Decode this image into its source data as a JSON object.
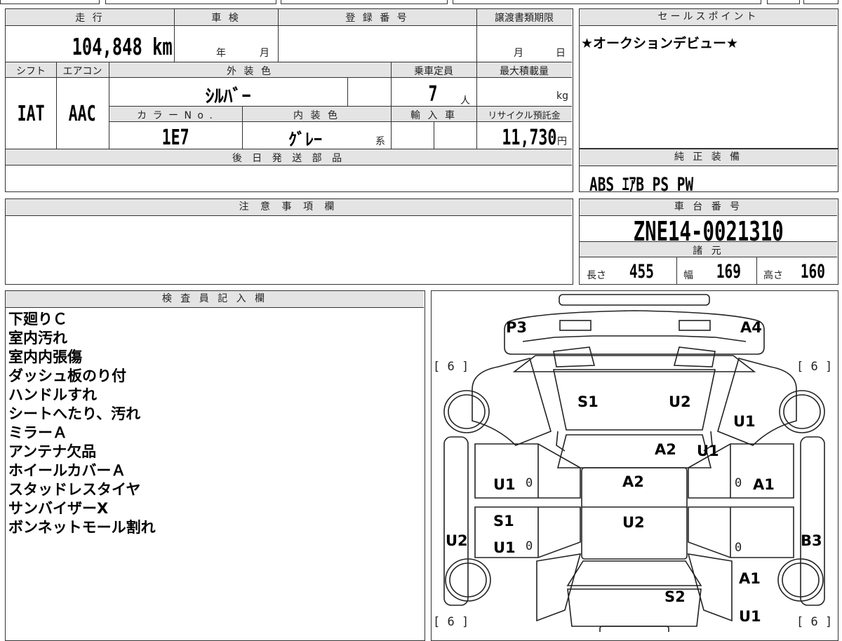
{
  "main": {
    "mileage_label": "走 行",
    "mileage_value": "104,848 km",
    "shaken_label": "車 検",
    "shaken_year": "年",
    "shaken_month": "月",
    "registration_label": "登 録 番 号",
    "registration_value": "",
    "transfer_label": "譲渡書類期限",
    "transfer_month": "月",
    "transfer_day": "日",
    "shift_label": "シフト",
    "shift_value": "IAT",
    "aircon_label": "エアコン",
    "aircon_value": "AAC",
    "exterior_label": "外 装 色",
    "exterior_value": "ｼﾙﾊﾞｰ",
    "capacity_label": "乗車定員",
    "capacity_value": "7",
    "capacity_unit": "人",
    "max_load_label": "最大積載量",
    "max_load_unit": "kg",
    "color_no_label": "カ ラ ー N o .",
    "color_no_value": "1E7",
    "interior_label": "内 装 色",
    "interior_value": "ｸﾞﾚｰ",
    "interior_suffix": "系",
    "import_label": "輸 入 車",
    "recycle_label": "リサイクル預託金",
    "recycle_value": "11,730",
    "recycle_unit": "円",
    "later_parts_label": "後 日 発 送 部 品"
  },
  "sales": {
    "label": "セールスポイント",
    "text": "★オークションデビュー★"
  },
  "equipment": {
    "label": "純 正 装 備",
    "value": "ABS ｴｱB PS PW"
  },
  "caution": {
    "label": "注 意 事 項 欄"
  },
  "chassis": {
    "label": "車 台 番 号",
    "value": "ZNE14-0021310"
  },
  "specs": {
    "label": "諸 元",
    "length_label": "長さ",
    "length_value": "455",
    "width_label": "幅",
    "width_value": "169",
    "height_label": "高さ",
    "height_value": "160"
  },
  "inspector": {
    "label": "検 査 員 記 入 欄",
    "notes": [
      "下廻りＣ",
      "室内汚れ",
      "室内内張傷",
      "ダッシュ板のり付",
      "ハンドルすれ",
      "シートへたり、汚れ",
      "ミラーＡ",
      "アンテナ欠品",
      "ホイールカバーＡ",
      "スタッドレスタイヤ",
      "サンバイザーX",
      "ボンネットモール割れ"
    ]
  },
  "diagram": {
    "labels": {
      "p3": "P3",
      "a4": "A4",
      "s1_front": "S1",
      "u2_front": "U2",
      "u1_rf": "U1",
      "a2_windshield": "A2",
      "u1_windshield": "U1",
      "u1_left": "U1",
      "a2_roof": "A2",
      "a1_right": "A1",
      "s1_left": "S1",
      "u2_roof": "U2",
      "u2_sill": "U2",
      "u1_left2": "U1",
      "b3_right": "B3",
      "a1_rr": "A1",
      "s2_rear": "S2",
      "u1_rr": "U1"
    },
    "tire_tl": "[ 6 ]",
    "tire_tr": "[ 6 ]",
    "tire_bl": "[ 6 ]",
    "tire_br": "[ 6 ]",
    "zero_ml": "0",
    "zero_mr": "0",
    "zero_ll": "0",
    "zero_lr": "0"
  }
}
